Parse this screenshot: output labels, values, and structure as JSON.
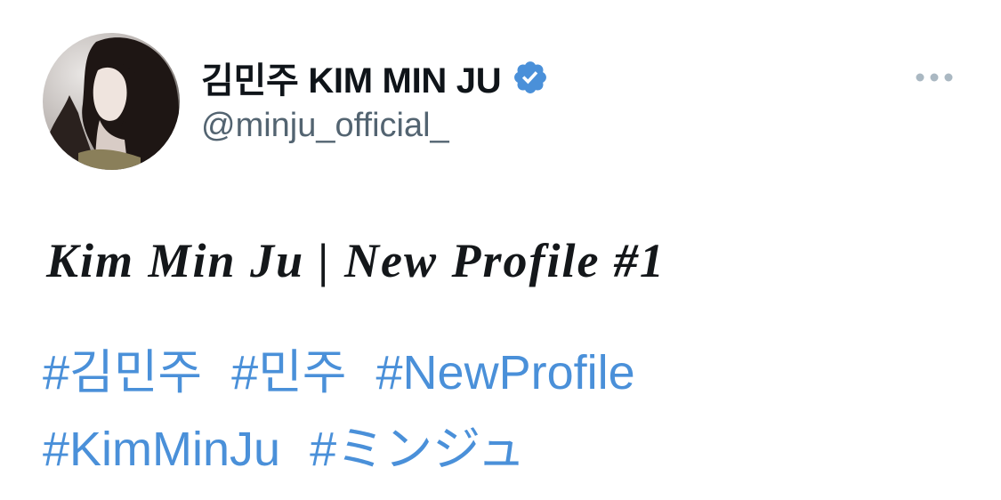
{
  "author": {
    "display_name": "김민주 KIM MIN JU",
    "handle": "@minju_official_",
    "verified": true
  },
  "icons": {
    "verified": "verified-badge-icon",
    "more": "more-dots-icon"
  },
  "tweet": {
    "title": "Kim Min Ju | New Profile #1",
    "hashtags_line1": [
      "#김민주",
      "#민주",
      "#NewProfile"
    ],
    "hashtags_line2": [
      "#KimMinJu",
      "#ミンジュ"
    ]
  },
  "colors": {
    "hashtag": "#4a90d9",
    "verified": "#4a90d9",
    "handle": "#536471",
    "text": "#0f1419"
  }
}
